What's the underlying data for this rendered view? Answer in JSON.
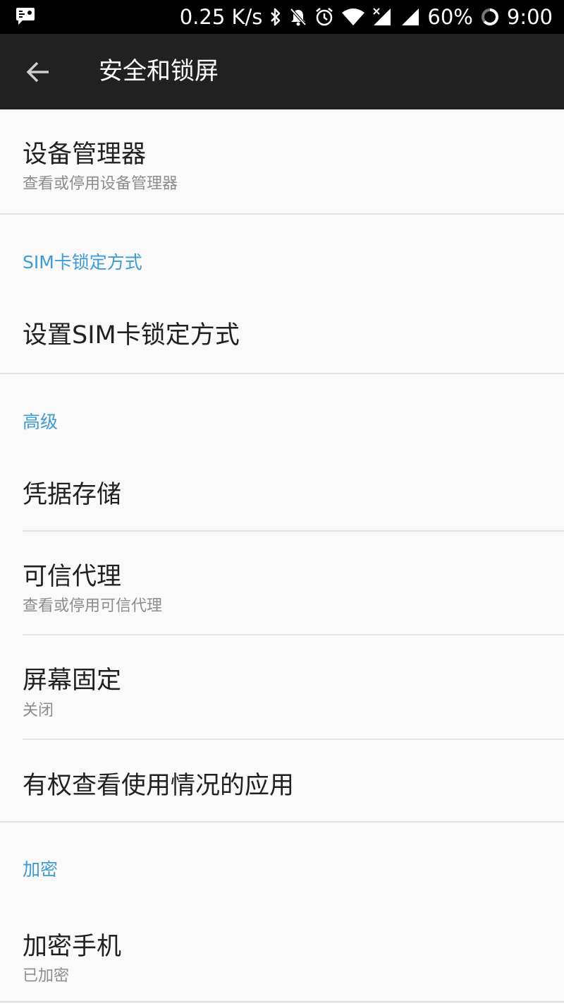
{
  "status_bar": {
    "network_speed": "0.25 K/s",
    "battery_percent": "60%",
    "time": "9:00",
    "icons": [
      "notification-icon",
      "bluetooth-icon",
      "mute-icon",
      "alarm-icon",
      "wifi-icon",
      "signal-icon",
      "signal-icon",
      "battery-icon"
    ]
  },
  "toolbar": {
    "title": "安全和锁屏",
    "back_icon": "arrow-back-icon"
  },
  "items": {
    "device_admin": {
      "title": "设备管理器",
      "subtitle": "查看或停用设备管理器"
    },
    "sim_lock": {
      "title": "设置SIM卡锁定方式"
    },
    "credential_storage": {
      "title": "凭据存储"
    },
    "trust_agents": {
      "title": "可信代理",
      "subtitle": "查看或停用可信代理"
    },
    "screen_pinning": {
      "title": "屏幕固定",
      "subtitle": "关闭"
    },
    "usage_access": {
      "title": "有权查看使用情况的应用"
    },
    "encrypt_phone": {
      "title": "加密手机",
      "subtitle": "已加密"
    }
  },
  "sections": {
    "sim_lock_header": "SIM卡锁定方式",
    "advanced_header": "高级",
    "encryption_header": "加密"
  },
  "colors": {
    "toolbar_bg": "#212121",
    "status_bar_bg": "#000000",
    "accent": "#3d9bd6",
    "background": "#fafafa"
  }
}
